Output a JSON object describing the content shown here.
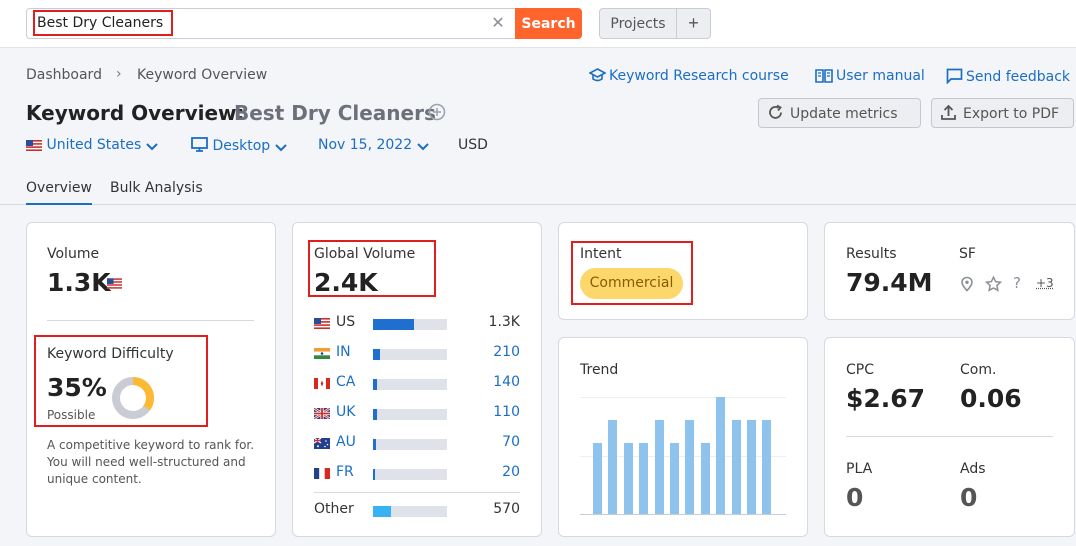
{
  "search": {
    "value": "Best Dry Cleaners",
    "button": "Search"
  },
  "topbar": {
    "projects": "Projects",
    "plus": "+"
  },
  "breadcrumb": [
    "Dashboard",
    "Keyword Overview"
  ],
  "links": {
    "course": "Keyword Research course",
    "manual": "User manual",
    "feedback": "Send feedback"
  },
  "title": {
    "prefix": "Keyword Overview:",
    "keyword": "Best Dry Cleaners"
  },
  "buttons": {
    "update": "Update metrics",
    "export": "Export to PDF"
  },
  "filters": {
    "country": "United States",
    "device": "Desktop",
    "date": "Nov 15, 2022",
    "currency": "USD"
  },
  "tabs": [
    "Overview",
    "Bulk Analysis"
  ],
  "volume": {
    "label": "Volume",
    "value": "1.3K"
  },
  "difficulty": {
    "label": "Keyword Difficulty",
    "value": "35%",
    "level": "Possible",
    "percent": 35,
    "description": "A competitive keyword to rank for. You will need well-structured and unique content."
  },
  "global": {
    "label": "Global Volume",
    "value": "2.4K",
    "countries": [
      {
        "code": "US",
        "value": "1.3K",
        "share": 0.55
      },
      {
        "code": "IN",
        "value": "210",
        "share": 0.09
      },
      {
        "code": "CA",
        "value": "140",
        "share": 0.06
      },
      {
        "code": "UK",
        "value": "110",
        "share": 0.05
      },
      {
        "code": "AU",
        "value": "70",
        "share": 0.04
      },
      {
        "code": "FR",
        "value": "20",
        "share": 0.03
      }
    ],
    "other": {
      "label": "Other",
      "value": "570",
      "share": 0.24
    }
  },
  "intent": {
    "label": "Intent",
    "value": "Commercial"
  },
  "trend": {
    "label": "Trend",
    "values": [
      0.55,
      0.72,
      0.55,
      0.55,
      0.72,
      0.55,
      0.72,
      0.55,
      0.9,
      0.72,
      0.72,
      0.72
    ]
  },
  "results": {
    "label": "Results",
    "value": "79.4M",
    "sf_label": "SF",
    "sf_more": "+3"
  },
  "cpc": {
    "label": "CPC",
    "value": "$2.67"
  },
  "com": {
    "label": "Com.",
    "value": "0.06"
  },
  "pla": {
    "label": "PLA",
    "value": "0"
  },
  "ads": {
    "label": "Ads",
    "value": "0"
  },
  "colors": {
    "accent": "#1a6ec4",
    "search": "#ff642d",
    "highlight": "#e01e1e",
    "intent": "#fcd76c",
    "trend": "#8dc3ed"
  }
}
